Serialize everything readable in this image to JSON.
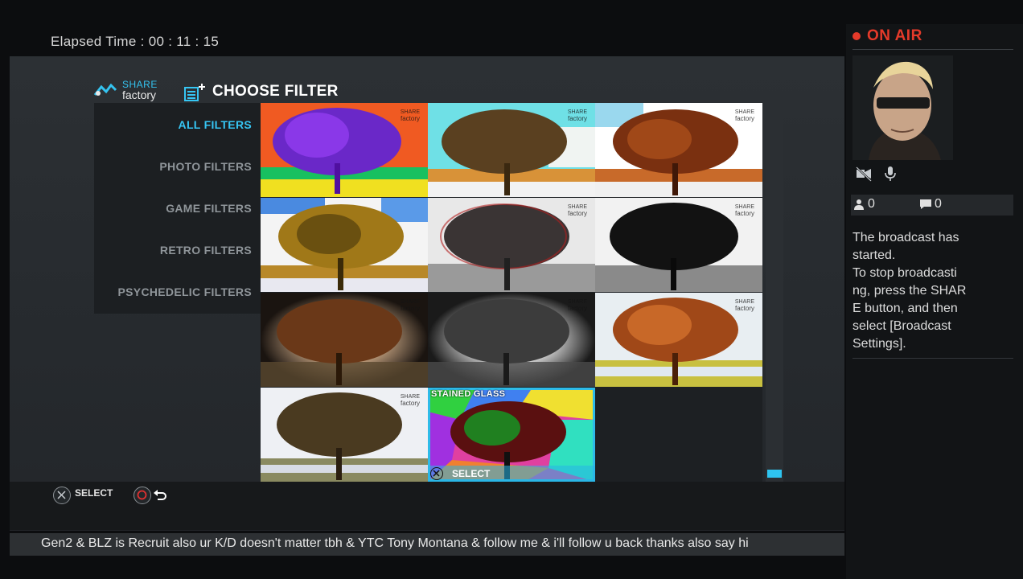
{
  "header": {
    "elapsed_label": "Elapsed Time",
    "elapsed_value": "00 : 11 : 15"
  },
  "app": {
    "brand_top": "SHARE",
    "brand_bottom": "factory",
    "title": "CHOOSE FILTER"
  },
  "categories": [
    {
      "label": "ALL FILTERS",
      "active": true
    },
    {
      "label": "PHOTO FILTERS",
      "active": false
    },
    {
      "label": "GAME FILTERS",
      "active": false
    },
    {
      "label": "RETRO FILTERS",
      "active": false
    },
    {
      "label": "PSYCHEDELIC FILTERS",
      "active": false
    }
  ],
  "watermark": {
    "top": "SHARE",
    "bottom": "factory"
  },
  "filters": [
    {
      "name": "filter-thermal"
    },
    {
      "name": "filter-posterize-cyan"
    },
    {
      "name": "filter-posterize-red"
    },
    {
      "name": "filter-posterize-blue"
    },
    {
      "name": "filter-anaglyph"
    },
    {
      "name": "filter-high-contrast"
    },
    {
      "name": "filter-vintage"
    },
    {
      "name": "filter-monochrome"
    },
    {
      "name": "filter-vivid"
    },
    {
      "name": "filter-natural"
    },
    {
      "name": "filter-stained-glass",
      "caption": "STAINED GLASS",
      "selected": true
    }
  ],
  "selected_hint": "SELECT",
  "controls": {
    "select_label": "SELECT"
  },
  "ticker": "Gen2 & BLZ is Recruit also ur K/D doesn't matter tbh & YTC Tony Montana & follow me & i'll follow u back thanks also say hi",
  "broadcast": {
    "status": "ON AIR",
    "viewers": "0",
    "comments": "0",
    "message_lines": [
      "The broadcast has",
      "started.",
      "To stop broadcasti",
      "ng, press the SHAR",
      "E button, and then",
      "select [Broadcast",
      "Settings]."
    ]
  },
  "colors": {
    "accent": "#36c6f4",
    "on_air": "#e53a2a"
  }
}
